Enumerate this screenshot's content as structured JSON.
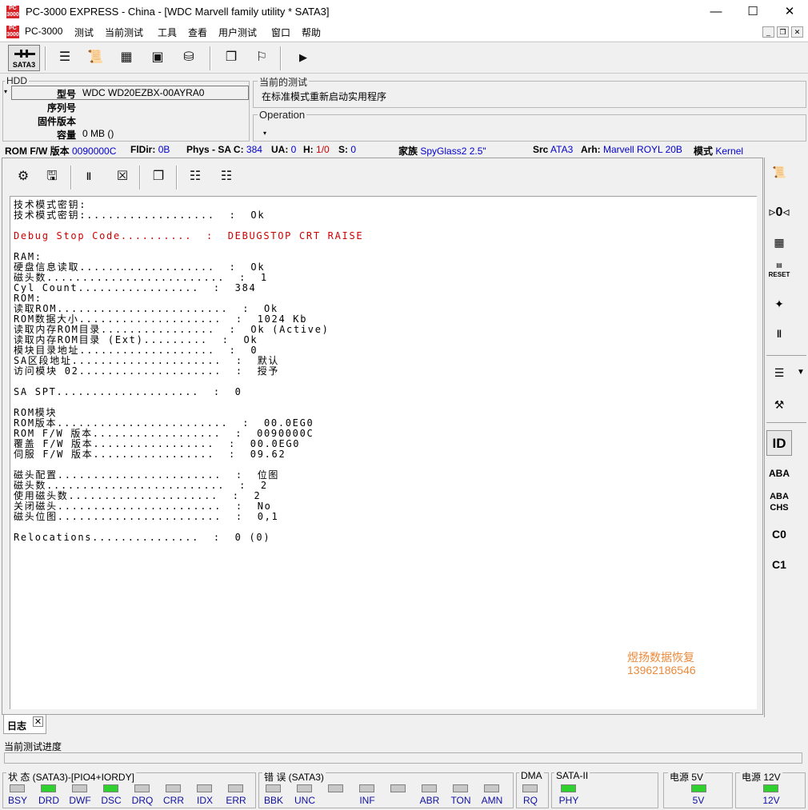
{
  "window": {
    "title": "PC-3000 EXPRESS - China - [WDC Marvell family utility * SATA3]",
    "app_icon_text": "PC 3000"
  },
  "menu": {
    "items": [
      "PC-3000",
      "测试",
      "当前测试",
      "工具",
      "查看",
      "用户测试",
      "窗口",
      "帮助"
    ]
  },
  "toolbar": {
    "sata_label": "SATA3"
  },
  "hdd": {
    "group_label": "HDD",
    "model_label": "型号",
    "model_value": "WDC WD20EZBX-00AYRA0",
    "serial_label": "序列号",
    "serial_value": "",
    "firmware_label": "固件版本",
    "firmware_value": "",
    "capacity_label": "容量",
    "capacity_value": "0 MB ()"
  },
  "current_test": {
    "group_label": "当前的测试",
    "value": "在标准模式重新启动实用程序",
    "operation_label": "Operation"
  },
  "info_line": {
    "rom_fw_label": "ROM F/W 版本",
    "rom_fw_value": "0090000C",
    "fldir_label": "FlDir:",
    "fldir_value": "0B",
    "phys_label": "Phys - SA C:",
    "phys_value": "384",
    "ua_label": "UA:",
    "ua_value": "0",
    "h_label": "H:",
    "h_value": "1/0",
    "s_label": "S:",
    "s_value": "0",
    "family_label": "家族",
    "family_value": "SpyGlass2 2.5\"",
    "src_label": "Src",
    "src_value": "ATA3",
    "arh_label": "Arh:",
    "arh_value": "Marvell ROYL 20B",
    "mode_label": "模式",
    "mode_value": "Kernel"
  },
  "log_lines": [
    {
      "text": "技术模式密钥:",
      "color": "#000000"
    },
    {
      "text": "技术模式密钥:..................  :  Ok",
      "color": "#000000"
    },
    {
      "text": "",
      "color": "#000000"
    },
    {
      "text": "Debug Stop Code..........  :  DEBUGSTOP CRT RAISE",
      "color": "#cc0000"
    },
    {
      "text": "",
      "color": "#000000"
    },
    {
      "text": "RAM:",
      "color": "#000000"
    },
    {
      "text": "硬盘信息读取...................  :  Ok",
      "color": "#000000"
    },
    {
      "text": "磁头数.........................  :  1",
      "color": "#000000"
    },
    {
      "text": "Cyl Count.................  :  384",
      "color": "#000000"
    },
    {
      "text": "ROM:",
      "color": "#000000"
    },
    {
      "text": "读取ROM........................  :  Ok",
      "color": "#000000"
    },
    {
      "text": "ROM数据大小....................  :  1024 Kb",
      "color": "#000000"
    },
    {
      "text": "读取内存ROM目录................  :  Ok (Active)",
      "color": "#000000"
    },
    {
      "text": "读取内存ROM目录 (Ext).........  :  Ok",
      "color": "#000000"
    },
    {
      "text": "模块目录地址...................  :  0",
      "color": "#000000"
    },
    {
      "text": "SA区段地址.....................  :  默认",
      "color": "#000000"
    },
    {
      "text": "访问模块 02....................  :  授予",
      "color": "#000000"
    },
    {
      "text": "",
      "color": "#000000"
    },
    {
      "text": "SA SPT....................  :  0",
      "color": "#000000"
    },
    {
      "text": "",
      "color": "#000000"
    },
    {
      "text": "ROM模块",
      "color": "#000000"
    },
    {
      "text": "ROM版本........................  :  00.0EG0",
      "color": "#000000"
    },
    {
      "text": "ROM F/W 版本..................  :  0090000C",
      "color": "#000000"
    },
    {
      "text": "覆盖 F/W 版本.................  :  00.0EG0",
      "color": "#000000"
    },
    {
      "text": "伺服 F/W 版本.................  :  09.62",
      "color": "#000000"
    },
    {
      "text": "",
      "color": "#000000"
    },
    {
      "text": "磁头配置.......................  :  位图",
      "color": "#000000"
    },
    {
      "text": "磁头数.........................  :  2",
      "color": "#000000"
    },
    {
      "text": "使用磁头数.....................  :  2",
      "color": "#000000"
    },
    {
      "text": "关闭磁头.......................  :  No",
      "color": "#000000"
    },
    {
      "text": "磁头位图.......................  :  0,1",
      "color": "#000000"
    },
    {
      "text": "",
      "color": "#000000"
    },
    {
      "text": "Relocations...............  :  0 (0)",
      "color": "#000000"
    }
  ],
  "watermark": {
    "line1": "煜扬数据恢复",
    "line2": "13962186546",
    "color": "#ec8a3a"
  },
  "sidebar": {
    "id_label": "ID",
    "aba_label": "ABA",
    "aba_chs_top": "ABA",
    "aba_chs_bottom": "CHS",
    "c0_label": "C0",
    "c1_label": "C1",
    "reset_label": "RESET"
  },
  "log_tab": {
    "label": "日志",
    "close": "✕"
  },
  "progress": {
    "label": "当前测试进度"
  },
  "status": {
    "state_label": "状 态 (SATA3)-[PIO4+IORDY]",
    "state_leds": [
      {
        "name": "BSY",
        "on": false
      },
      {
        "name": "DRD",
        "on": true
      },
      {
        "name": "DWF",
        "on": false
      },
      {
        "name": "DSC",
        "on": true
      },
      {
        "name": "DRQ",
        "on": false
      },
      {
        "name": "CRR",
        "on": false
      },
      {
        "name": "IDX",
        "on": false
      },
      {
        "name": "ERR",
        "on": false
      }
    ],
    "error_label": "错 误 (SATA3)",
    "error_leds": [
      {
        "name": "BBK",
        "on": false
      },
      {
        "name": "UNC",
        "on": false
      },
      {
        "name": "",
        "on": false
      },
      {
        "name": "INF",
        "on": false
      },
      {
        "name": "",
        "on": false
      },
      {
        "name": "ABR",
        "on": false
      },
      {
        "name": "TON",
        "on": false
      },
      {
        "name": "AMN",
        "on": false
      }
    ],
    "dma_label": "DMA",
    "dma_led": "RQ",
    "sata_label": "SATA-II",
    "sata_led": "PHY",
    "power5_label": "电源 5V",
    "power5_led": "5V",
    "power12_label": "电源 12V",
    "power12_led": "12V",
    "led_on_color": "#2fd12f"
  }
}
